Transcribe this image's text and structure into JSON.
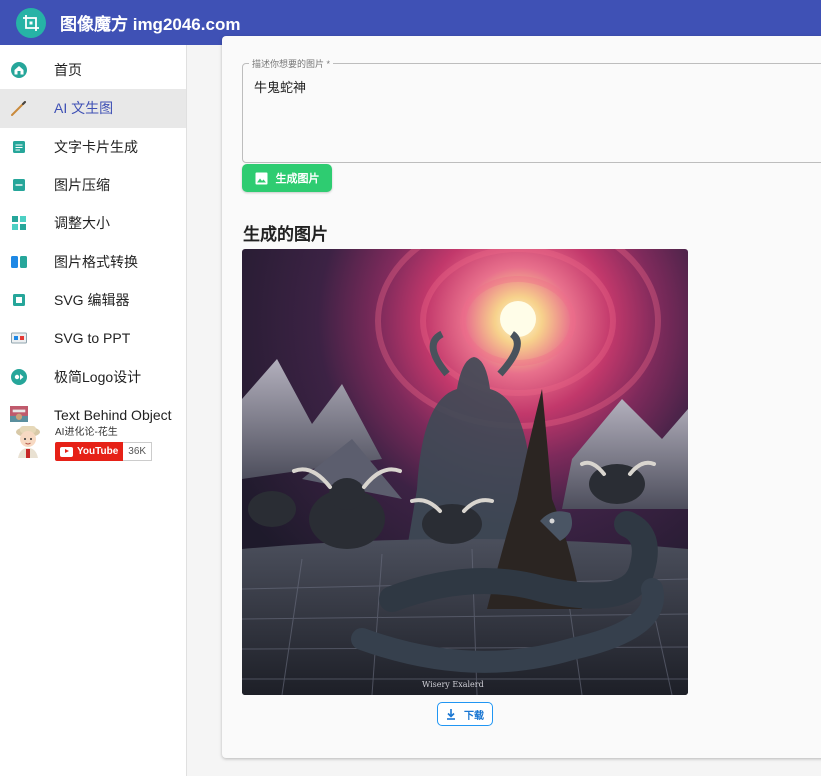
{
  "header": {
    "title": "图像魔方 img2046.com",
    "logo_icon": "crop-frame-icon"
  },
  "sidebar": {
    "items": [
      {
        "label": "首页",
        "icon": "home-icon"
      },
      {
        "label": "AI 文生图",
        "icon": "magic-wand-icon",
        "active": true
      },
      {
        "label": "文字卡片生成",
        "icon": "text-card-icon"
      },
      {
        "label": "图片压缩",
        "icon": "compress-icon"
      },
      {
        "label": "调整大小",
        "icon": "resize-icon"
      },
      {
        "label": "图片格式转换",
        "icon": "convert-icon"
      },
      {
        "label": "SVG 编辑器",
        "icon": "svg-editor-icon"
      },
      {
        "label": "SVG to PPT",
        "icon": "ppt-icon"
      },
      {
        "label": "极简Logo设计",
        "icon": "logo-design-icon"
      },
      {
        "label": "Text Behind Object",
        "icon": "text-behind-object-icon"
      }
    ],
    "profile": {
      "name": "AI进化论-花生",
      "youtube_label": "YouTube",
      "subscriber_count": "36K"
    }
  },
  "main": {
    "prompt": {
      "label": "描述你想要的图片 *",
      "value": "牛鬼蛇神"
    },
    "generate_button": "生成图片",
    "result_title": "生成的图片",
    "image_watermark": "Wisery Exalerd",
    "download_button": "下载"
  },
  "colors": {
    "primary": "#3f51b5",
    "accent": "#2ecc71",
    "teal": "#26b3a6"
  }
}
